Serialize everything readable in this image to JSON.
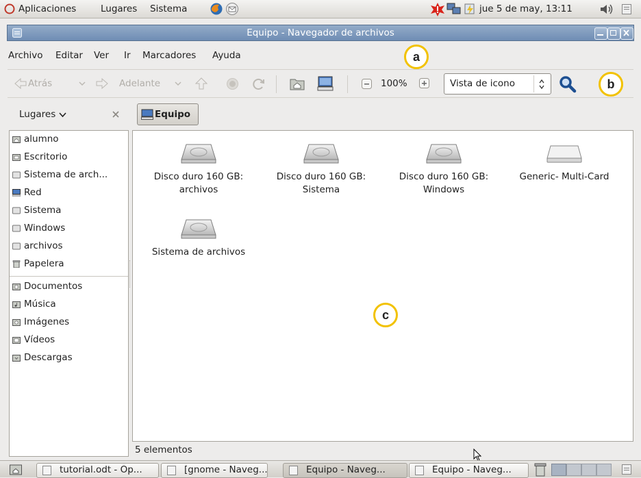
{
  "top_panel": {
    "menus": [
      "Aplicaciones",
      "Lugares",
      "Sistema"
    ],
    "clock": "jue  5 de may, 13:11"
  },
  "window": {
    "title": "Equipo - Navegador de archivos"
  },
  "menubar": {
    "items": [
      "Archivo",
      "Editar",
      "Ver",
      "Ir",
      "Marcadores",
      "Ayuda"
    ]
  },
  "toolbar": {
    "back": "Atrás",
    "forward": "Adelante",
    "zoom": "100%",
    "view_mode": "Vista de icono"
  },
  "location": {
    "places_label": "Lugares",
    "path_button": "Equipo"
  },
  "sidebar": {
    "items": [
      "alumno",
      "Escritorio",
      "Sistema de arch...",
      "Red",
      "Sistema",
      "Windows",
      "archivos",
      "Papelera",
      "Documentos",
      "Música",
      "Imágenes",
      "Vídeos",
      "Descargas"
    ]
  },
  "main": {
    "files": [
      {
        "line1": "Disco duro 160 GB:",
        "line2": "archivos"
      },
      {
        "line1": "Disco duro 160 GB:",
        "line2": "Sistema"
      },
      {
        "line1": "Disco duro 160 GB:",
        "line2": "Windows"
      },
      {
        "line1": "Generic- Multi-Card",
        "line2": ""
      },
      {
        "line1": "Sistema de archivos",
        "line2": ""
      }
    ]
  },
  "statusbar": {
    "text": "5 elementos"
  },
  "taskbar": {
    "tasks": [
      "tutorial.odt - Op...",
      "[gnome - Naveg...",
      "Equipo - Naveg...",
      "Equipo - Naveg..."
    ]
  },
  "callouts": [
    "a",
    "b",
    "c"
  ],
  "colors": {
    "titlebar": "#7b97bc",
    "callout_ring": "#f2c200",
    "panel": "#dcdad5"
  }
}
